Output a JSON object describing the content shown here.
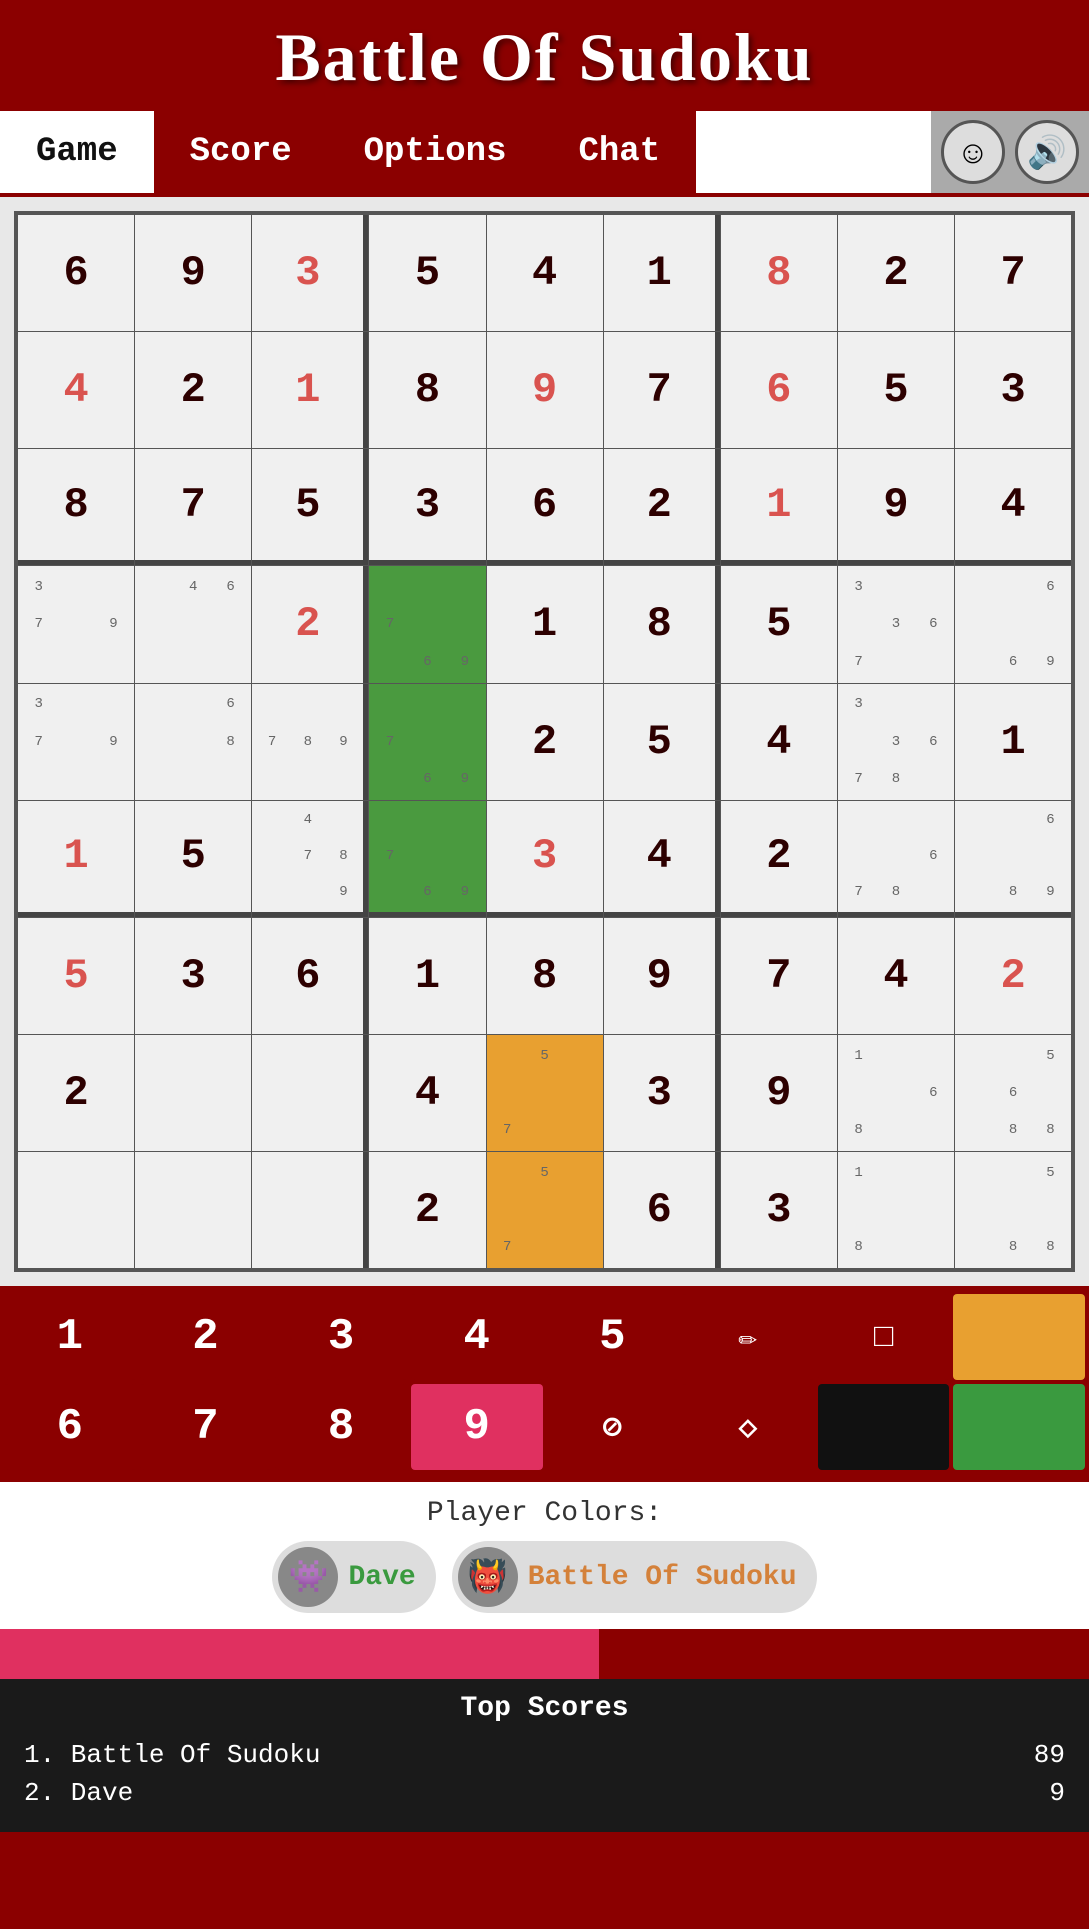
{
  "header": {
    "title": "Battle Of Sudoku"
  },
  "nav": {
    "tabs": [
      {
        "id": "game",
        "label": "Game",
        "active": true
      },
      {
        "id": "score",
        "label": "Score",
        "active": false
      },
      {
        "id": "options",
        "label": "Options",
        "active": false
      },
      {
        "id": "chat",
        "label": "Chat",
        "active": false
      }
    ],
    "emoji_icon": "☺",
    "sound_icon": "🔊"
  },
  "board": {
    "cells": [
      [
        {
          "v": "6",
          "t": "given"
        },
        {
          "v": "9",
          "t": "given"
        },
        {
          "v": "3",
          "t": "hint-pink"
        },
        {
          "v": "5",
          "t": "given"
        },
        {
          "v": "4",
          "t": "given"
        },
        {
          "v": "1",
          "t": "given"
        },
        {
          "v": "8",
          "t": "hint-pink"
        },
        {
          "v": "2",
          "t": "given"
        },
        {
          "v": "7",
          "t": "given"
        }
      ],
      [
        {
          "v": "4",
          "t": "hint-pink"
        },
        {
          "v": "2",
          "t": "given"
        },
        {
          "v": "1",
          "t": "hint-pink"
        },
        {
          "v": "8",
          "t": "given"
        },
        {
          "v": "9",
          "t": "hint-pink"
        },
        {
          "v": "7",
          "t": "given"
        },
        {
          "v": "6",
          "t": "hint-pink"
        },
        {
          "v": "5",
          "t": "given"
        },
        {
          "v": "3",
          "t": "given"
        }
      ],
      [
        {
          "v": "8",
          "t": "given"
        },
        {
          "v": "7",
          "t": "given"
        },
        {
          "v": "5",
          "t": "given"
        },
        {
          "v": "3",
          "t": "given"
        },
        {
          "v": "6",
          "t": "given"
        },
        {
          "v": "2",
          "t": "given"
        },
        {
          "v": "1",
          "t": "hint-pink"
        },
        {
          "v": "9",
          "t": "given"
        },
        {
          "v": "4",
          "t": "given"
        }
      ],
      [
        {
          "v": "",
          "t": "notes",
          "notes": [
            "3",
            "",
            "",
            "7",
            "",
            "9",
            "",
            "",
            ""
          ]
        },
        {
          "v": "",
          "t": "notes",
          "notes": [
            "",
            "4",
            "6",
            "",
            "",
            "",
            "",
            "",
            ""
          ]
        },
        {
          "v": "2",
          "t": "hint-pink"
        },
        {
          "v": "",
          "t": "selected-green",
          "notes": [
            "",
            "",
            "",
            "7",
            "",
            "",
            "",
            "6",
            "9"
          ]
        },
        {
          "v": "1",
          "t": "given"
        },
        {
          "v": "8",
          "t": "given"
        },
        {
          "v": "5",
          "t": "given"
        },
        {
          "v": "",
          "t": "notes",
          "notes": [
            "3",
            "",
            "",
            "",
            "3",
            "6",
            "7",
            "",
            ""
          ]
        },
        {
          "v": "",
          "t": "notes",
          "notes": [
            "",
            "",
            "6",
            "",
            "",
            "",
            "",
            "6",
            "9"
          ]
        }
      ],
      [
        {
          "v": "",
          "t": "notes",
          "notes": [
            "3",
            "",
            "",
            "7",
            "",
            "9",
            "",
            "",
            ""
          ]
        },
        {
          "v": "",
          "t": "notes",
          "notes": [
            "",
            "",
            "6",
            "",
            "",
            "8",
            "",
            "",
            ""
          ]
        },
        {
          "v": "",
          "t": "notes",
          "notes": [
            "",
            "",
            "",
            "7",
            "8",
            "9",
            "",
            "",
            ""
          ]
        },
        {
          "v": "",
          "t": "selected-green",
          "notes": [
            "",
            "",
            "",
            "7",
            "",
            "",
            "",
            "6",
            "9"
          ]
        },
        {
          "v": "2",
          "t": "given"
        },
        {
          "v": "5",
          "t": "given"
        },
        {
          "v": "4",
          "t": "given"
        },
        {
          "v": "",
          "t": "notes",
          "notes": [
            "3",
            "",
            "",
            "",
            "3",
            "6",
            "7",
            "8",
            ""
          ]
        },
        {
          "v": "1",
          "t": "given"
        }
      ],
      [
        {
          "v": "1",
          "t": "hint-pink"
        },
        {
          "v": "5",
          "t": "given"
        },
        {
          "v": "",
          "t": "notes",
          "notes": [
            "",
            "4",
            "",
            "",
            "7",
            "8",
            "",
            "",
            "9"
          ]
        },
        {
          "v": "",
          "t": "selected-green",
          "notes": [
            "",
            "",
            "",
            "7",
            "",
            "",
            "",
            "6",
            "9"
          ]
        },
        {
          "v": "3",
          "t": "hint-pink"
        },
        {
          "v": "4",
          "t": "given"
        },
        {
          "v": "2",
          "t": "given"
        },
        {
          "v": "",
          "t": "notes",
          "notes": [
            "",
            "",
            "",
            "",
            "",
            "6",
            "7",
            "8",
            ""
          ]
        },
        {
          "v": "",
          "t": "notes",
          "notes": [
            "",
            "",
            "6",
            "",
            "",
            "",
            "",
            "8",
            "9"
          ]
        }
      ],
      [
        {
          "v": "5",
          "t": "hint-pink"
        },
        {
          "v": "3",
          "t": "given"
        },
        {
          "v": "6",
          "t": "given"
        },
        {
          "v": "1",
          "t": "given"
        },
        {
          "v": "8",
          "t": "given"
        },
        {
          "v": "9",
          "t": "given"
        },
        {
          "v": "7",
          "t": "given"
        },
        {
          "v": "4",
          "t": "given"
        },
        {
          "v": "2",
          "t": "hint-pink"
        }
      ],
      [
        {
          "v": "2",
          "t": "given"
        },
        {
          "v": "",
          "t": "empty"
        },
        {
          "v": "",
          "t": "empty"
        },
        {
          "v": "4",
          "t": "given"
        },
        {
          "v": "",
          "t": "selected-orange",
          "notes": [
            "",
            "5",
            "",
            "",
            "",
            "",
            "7",
            "",
            ""
          ]
        },
        {
          "v": "3",
          "t": "given"
        },
        {
          "v": "9",
          "t": "given"
        },
        {
          "v": "",
          "t": "notes",
          "notes": [
            "1",
            "",
            "",
            "",
            "",
            "6",
            "8",
            "",
            ""
          ]
        },
        {
          "v": "",
          "t": "notes",
          "notes": [
            "",
            "",
            "5",
            "",
            "6",
            "",
            "",
            "8",
            "8"
          ]
        }
      ],
      [
        {
          "v": "",
          "t": "empty"
        },
        {
          "v": "",
          "t": "empty"
        },
        {
          "v": "",
          "t": "empty"
        },
        {
          "v": "2",
          "t": "given"
        },
        {
          "v": "",
          "t": "selected-orange",
          "notes": [
            "",
            "5",
            "",
            "",
            "",
            "",
            "7",
            "",
            ""
          ]
        },
        {
          "v": "6",
          "t": "given"
        },
        {
          "v": "3",
          "t": "given"
        },
        {
          "v": "",
          "t": "notes",
          "notes": [
            "1",
            "",
            "",
            "",
            "",
            "",
            "8",
            "",
            ""
          ]
        },
        {
          "v": "",
          "t": "notes",
          "notes": [
            "",
            "",
            "5",
            "",
            "",
            "",
            "",
            "8",
            "8"
          ]
        }
      ]
    ]
  },
  "numpad": {
    "row1": [
      {
        "label": "1",
        "type": "number"
      },
      {
        "label": "2",
        "type": "number"
      },
      {
        "label": "3",
        "type": "number"
      },
      {
        "label": "4",
        "type": "number"
      },
      {
        "label": "5",
        "type": "number"
      },
      {
        "label": "✏",
        "type": "tool",
        "name": "pencil"
      },
      {
        "label": "□",
        "type": "tool",
        "name": "square"
      },
      {
        "label": "",
        "type": "color",
        "color": "orange",
        "name": "color-orange"
      }
    ],
    "row2": [
      {
        "label": "6",
        "type": "number"
      },
      {
        "label": "7",
        "type": "number"
      },
      {
        "label": "8",
        "type": "number"
      },
      {
        "label": "9",
        "type": "number",
        "active": true
      },
      {
        "label": "⊘",
        "type": "tool",
        "name": "erase"
      },
      {
        "label": "◇",
        "type": "tool",
        "name": "diamond"
      },
      {
        "label": "",
        "type": "color",
        "color": "black",
        "name": "color-black"
      },
      {
        "label": "",
        "type": "color",
        "color": "green",
        "name": "color-green"
      }
    ]
  },
  "player_colors": {
    "title": "Player Colors:",
    "players": [
      {
        "name": "Dave",
        "color": "green",
        "avatar": "👾"
      },
      {
        "name": "Battle Of Sudoku",
        "color": "orange",
        "avatar": "👹"
      }
    ]
  },
  "top_scores": {
    "title": "Top Scores",
    "entries": [
      {
        "rank": "1.",
        "name": "Battle Of Sudoku",
        "score": "89"
      },
      {
        "rank": "2.",
        "name": "Dave",
        "score": "9"
      }
    ]
  }
}
